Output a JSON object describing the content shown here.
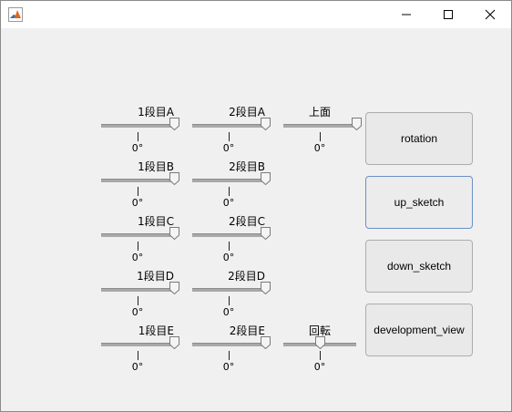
{
  "window": {
    "title": ""
  },
  "controls": {
    "r1a": {
      "label": "1段目A",
      "value": "0°",
      "level": 1.0
    },
    "r2a": {
      "label": "2段目A",
      "value": "0°",
      "level": 1.0
    },
    "top": {
      "label": "上面",
      "value": "0°",
      "level": 1.0
    },
    "r1b": {
      "label": "1段目B",
      "value": "0°",
      "level": 1.0
    },
    "r2b": {
      "label": "2段目B",
      "value": "0°",
      "level": 1.0
    },
    "r1c": {
      "label": "1段目C",
      "value": "0°",
      "level": 1.0
    },
    "r2c": {
      "label": "2段目C",
      "value": "0°",
      "level": 1.0
    },
    "r1d": {
      "label": "1段目D",
      "value": "0°",
      "level": 1.0
    },
    "r2d": {
      "label": "2段目D",
      "value": "0°",
      "level": 1.0
    },
    "r1e": {
      "label": "1段目E",
      "value": "0°",
      "level": 1.0
    },
    "r2e": {
      "label": "2段目E",
      "value": "0°",
      "level": 1.0
    },
    "rot": {
      "label": "回転",
      "value": "0°",
      "level": 0.5
    }
  },
  "buttons": {
    "rotation": "rotation",
    "up_sketch": "up_sketch",
    "down_sketch": "down_sketch",
    "development_view": "development_view"
  },
  "colors": {
    "accent": "#6a90c8",
    "background": "#f0f0f0"
  },
  "icons": {
    "app": "matlab-icon",
    "minimize": "minimize-icon",
    "maximize": "maximize-icon",
    "close": "close-icon"
  }
}
